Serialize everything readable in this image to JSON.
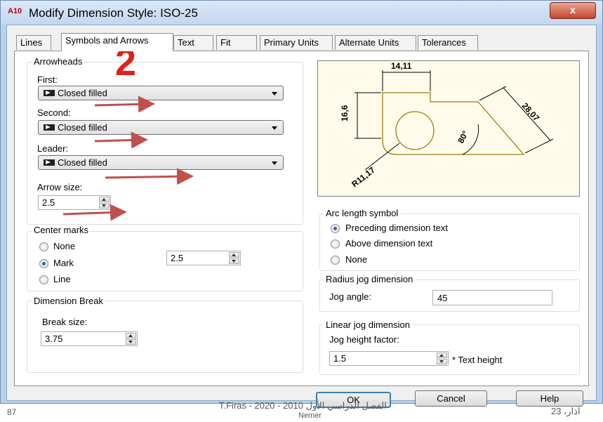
{
  "window": {
    "title": "Modify Dimension Style: ISO-25",
    "app_icon_text": "A10",
    "close_label": "x"
  },
  "tabs": [
    {
      "label": "Lines",
      "active": false
    },
    {
      "label": "Symbols and Arrows",
      "active": true
    },
    {
      "label": "Text",
      "active": false
    },
    {
      "label": "Fit",
      "active": false
    },
    {
      "label": "Primary Units",
      "active": false
    },
    {
      "label": "Alternate Units",
      "active": false
    },
    {
      "label": "Tolerances",
      "active": false
    }
  ],
  "arrowheads": {
    "title": "Arrowheads",
    "first_label": "First:",
    "first_value": "Closed filled",
    "second_label": "Second:",
    "second_value": "Closed filled",
    "leader_label": "Leader:",
    "leader_value": "Closed filled",
    "arrow_size_label": "Arrow size:",
    "arrow_size_value": "2.5"
  },
  "center_marks": {
    "title": "Center marks",
    "options": [
      "None",
      "Mark",
      "Line"
    ],
    "selected": "Mark",
    "value": "2.5"
  },
  "dimension_break": {
    "title": "Dimension Break",
    "break_size_label": "Break size:",
    "break_size_value": "3.75"
  },
  "preview": {
    "dim_top": "14,11",
    "dim_left": "16,6",
    "dim_diag": "28,07",
    "dim_angle": "80°",
    "dim_radius": "R11,17"
  },
  "arc_length": {
    "title": "Arc length symbol",
    "options": [
      "Preceding dimension text",
      "Above dimension text",
      "None"
    ],
    "selected": "Preceding dimension text"
  },
  "radius_jog": {
    "title": "Radius jog dimension",
    "jog_angle_label": "Jog angle:",
    "jog_angle_value": "45"
  },
  "linear_jog": {
    "title": "Linear jog dimension",
    "height_factor_label": "Jog height factor:",
    "height_factor_value": "1.5",
    "suffix": "* Text height"
  },
  "buttons": {
    "ok": "OK",
    "cancel": "Cancel",
    "help": "Help"
  },
  "annotation": {
    "step_number": "2"
  },
  "slide_footer": {
    "page_left": "87",
    "author": "T.Firas  -  2020 - 2010 الفصل الدراسي الأول",
    "author2": "Nemer",
    "date_right": "آذار، 23"
  },
  "colors": {
    "annotation_red": "#e0211a",
    "arrow_red": "#c0504d",
    "preview_bg": "#fffbea",
    "preview_line": "#a07a10"
  }
}
